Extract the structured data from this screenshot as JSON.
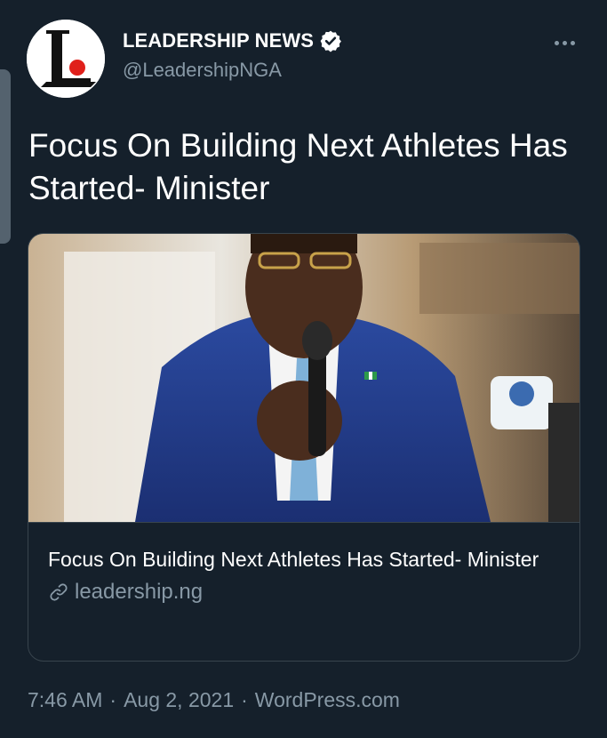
{
  "account": {
    "display_name": "LEADERSHIP NEWS",
    "handle": "@LeadershipNGA",
    "avatar_letter": "L",
    "verified": true
  },
  "tweet": {
    "text": "Focus On Building Next Athletes Has Started- Minister"
  },
  "card": {
    "title": "Focus On Building Next Athletes Has Started- Minister",
    "domain": "leadership.ng",
    "image_icon": "minister-photo"
  },
  "meta": {
    "time": "7:46 AM",
    "separator": "·",
    "date": "Aug 2, 2021",
    "source": "WordPress.com"
  },
  "icons": {
    "more": "more-options-icon",
    "verified": "verified-badge-icon",
    "link": "link-icon"
  },
  "colors": {
    "background": "#15202b",
    "text_primary": "#ffffff",
    "text_secondary": "#8899a6",
    "border": "#38444d",
    "avatar_accent": "#e0201b"
  }
}
